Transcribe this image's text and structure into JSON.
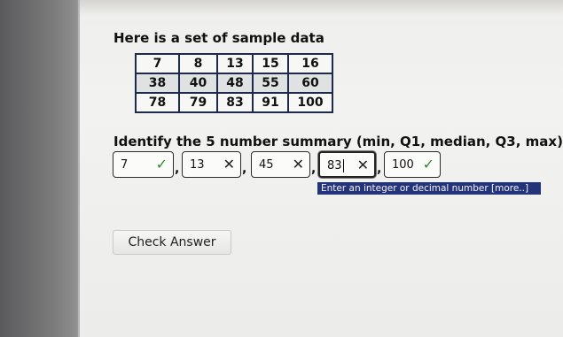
{
  "heading": "Here is a set of sample data",
  "data_table": {
    "rows": [
      [
        "7",
        "8",
        "13",
        "15",
        "16"
      ],
      [
        "38",
        "40",
        "48",
        "55",
        "60"
      ],
      [
        "78",
        "79",
        "83",
        "91",
        "100"
      ]
    ]
  },
  "question": "Identify the 5 number summary (min, Q1, median, Q3, max)",
  "answers": [
    {
      "value": "7",
      "status": "correct",
      "mark": "✓"
    },
    {
      "value": "13",
      "status": "incorrect",
      "mark": "✕"
    },
    {
      "value": "45",
      "status": "incorrect",
      "mark": "✕"
    },
    {
      "value": "83",
      "status": "incorrect",
      "mark": "✕"
    },
    {
      "value": "100",
      "status": "correct",
      "mark": "✓"
    }
  ],
  "separator": ",",
  "tooltip": "Enter an integer or decimal number [more..]",
  "check_button": "Check Answer",
  "colors": {
    "correct": "#2f8a2f",
    "tooltip_bg": "#24347a",
    "table_border": "#1d2a4a"
  }
}
